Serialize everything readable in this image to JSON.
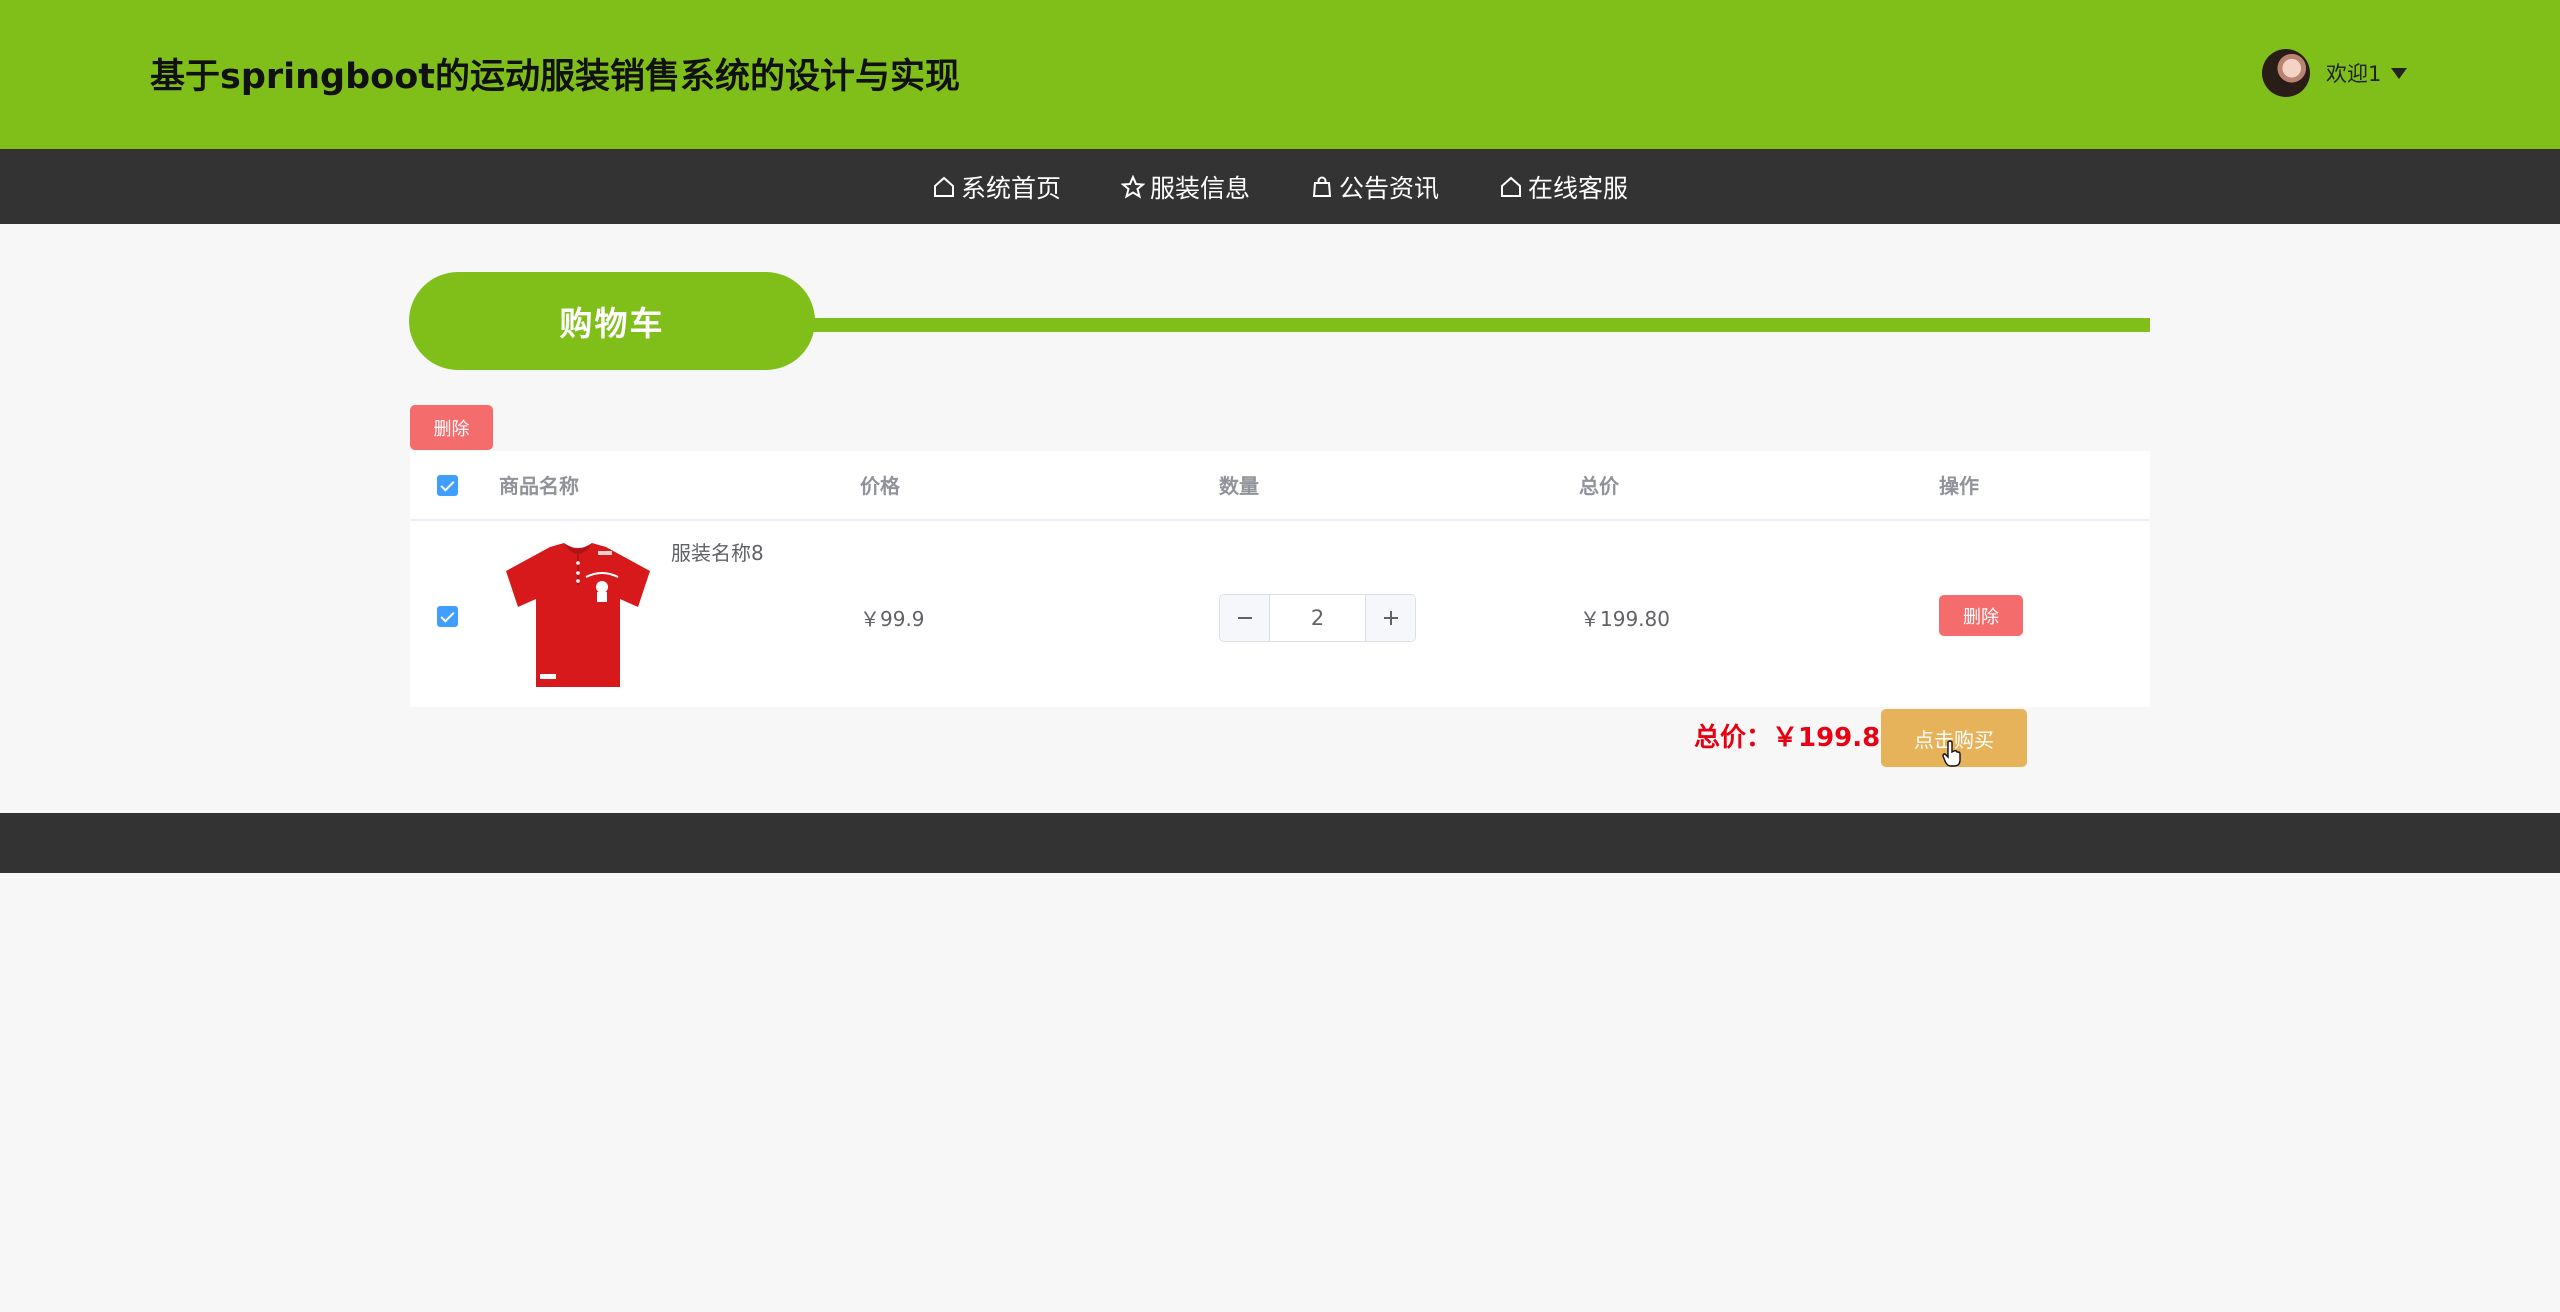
{
  "header": {
    "title": "基于springboot的运动服装销售系统的设计与实现",
    "welcome": "欢迎1"
  },
  "nav": {
    "items": [
      {
        "label": "系统首页",
        "icon": "home-icon"
      },
      {
        "label": "服装信息",
        "icon": "star-icon"
      },
      {
        "label": "公告资讯",
        "icon": "bag-icon"
      },
      {
        "label": "在线客服",
        "icon": "home-icon"
      }
    ]
  },
  "section": {
    "title": "购物车"
  },
  "toolbar": {
    "delete_label": "删除"
  },
  "table": {
    "columns": [
      "商品名称",
      "价格",
      "数量",
      "总价",
      "操作"
    ],
    "rows": [
      {
        "name": "服装名称8",
        "price": "￥99.9",
        "quantity": "2",
        "total": "￥199.80",
        "action": "删除"
      }
    ]
  },
  "summary": {
    "total": "总价：￥199.80",
    "buy_label": "点击购买"
  },
  "colors": {
    "brand": "#80bf1a",
    "dark": "#333333",
    "danger": "#f56c6c",
    "price": "#e60012",
    "buy": "#e6b35b"
  }
}
